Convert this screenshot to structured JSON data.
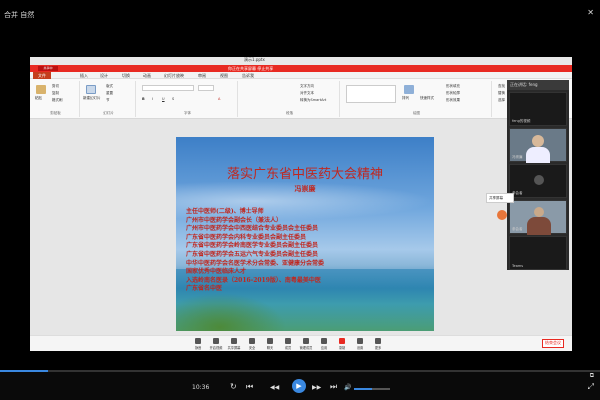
{
  "app": {
    "title": "合并 自然",
    "close_icon": "close-icon"
  },
  "window": {
    "title": "演示1.pptx",
    "share_tag": "共享中",
    "share_text": "你正在共享屏幕 停止共享"
  },
  "ribbon_tabs": [
    "文件",
    "插入",
    "设计",
    "切换",
    "动画",
    "幻灯片放映",
    "审阅",
    "视图",
    "告诉我"
  ],
  "ribbon_groups": [
    {
      "label": "剪贴板",
      "buttons": [
        "粘贴",
        "剪切",
        "复制",
        "格式刷"
      ]
    },
    {
      "label": "幻灯片",
      "buttons": [
        "新建幻灯片",
        "版式",
        "重置",
        "节"
      ]
    },
    {
      "label": "字体",
      "buttons": [
        "B",
        "I",
        "U",
        "S",
        "A"
      ]
    },
    {
      "label": "段落",
      "buttons": [
        "文字方向",
        "对齐文本",
        "转换为SmartArt"
      ]
    },
    {
      "label": "绘图",
      "buttons": [
        "排列",
        "快速样式",
        "形状填充",
        "形状轮廓",
        "形状效果"
      ]
    },
    {
      "label": "编辑",
      "buttons": [
        "查找",
        "替换",
        "选择"
      ]
    }
  ],
  "slide": {
    "title": "落实广东省中医药大会精神",
    "author": "冯崇廉",
    "lines": [
      "主任中医师(二级)、博士导师",
      "广州市中医药学会副会长（兼法人）",
      "广州市中医药学会中西医结合专业委员会主任委员",
      "广东省中医药学会内科专业委员会副主任委员",
      "广东省中医药学会岭南医学专业委员会副主任委员",
      "广东省中医药学会五运六气专业委员会副主任委员",
      "中华中医药学会名医学术分会常委、亚健康分会常委",
      "国家优秀中医临床人才",
      "入选岭南名医录（2016-2019版）、南粤最美中医",
      "广东省名中医"
    ]
  },
  "status_bar": {
    "zoom_label": "结束共享"
  },
  "participants": {
    "header": "正在讲话: feng",
    "tiles": [
      {
        "name": "feng的视频"
      },
      {
        "name": "冯崇廉"
      },
      {
        "name": "参会者"
      },
      {
        "name": "参会者"
      },
      {
        "name": "Teams"
      }
    ]
  },
  "share_popup": "共享屏幕",
  "meeting_toolbar": {
    "buttons": [
      "静音",
      "开启视频",
      "共享屏幕",
      "安全",
      "聊天",
      "成员",
      "管理成员",
      "应用",
      "录制",
      "设置",
      "更多"
    ],
    "leave": "结束会议"
  },
  "player": {
    "current_time": "10:36",
    "progress": 0.08,
    "volume": 0.5,
    "buttons": {
      "loop": "↻",
      "rewind": "⏮",
      "back": "◀◀",
      "play": "▶",
      "forward": "▶▶",
      "next": "⏭",
      "volume_icon": "🔊",
      "fullscreen": "⤢",
      "pip": "⧉"
    }
  }
}
